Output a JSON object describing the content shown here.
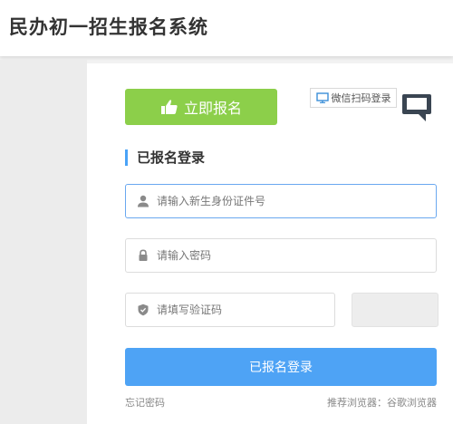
{
  "header": {
    "title": "民办初一招生报名系统"
  },
  "register_button": {
    "label": "立即报名",
    "icon": "thumbs-up-icon",
    "color": "#8ccf4a"
  },
  "wechat_login": {
    "label": "微信扫码登录",
    "icon": "monitor-icon"
  },
  "qr_toggle": {
    "icon": "qr-monitor-icon"
  },
  "login_section": {
    "title": "已报名登录",
    "accent": "#4aa3f7"
  },
  "fields": {
    "id_number": {
      "placeholder": "请输入新生身份证件号",
      "value": "",
      "icon": "user-icon"
    },
    "password": {
      "placeholder": "请输入密码",
      "value": "",
      "icon": "lock-icon"
    },
    "captcha": {
      "placeholder": "请填写验证码",
      "value": "",
      "icon": "shield-icon"
    }
  },
  "login_button": {
    "label": "已报名登录",
    "color": "#4ea3f5"
  },
  "footer": {
    "forgot_password": "忘记密码",
    "browser_tip": "推荐浏览器：谷歌浏览器"
  }
}
